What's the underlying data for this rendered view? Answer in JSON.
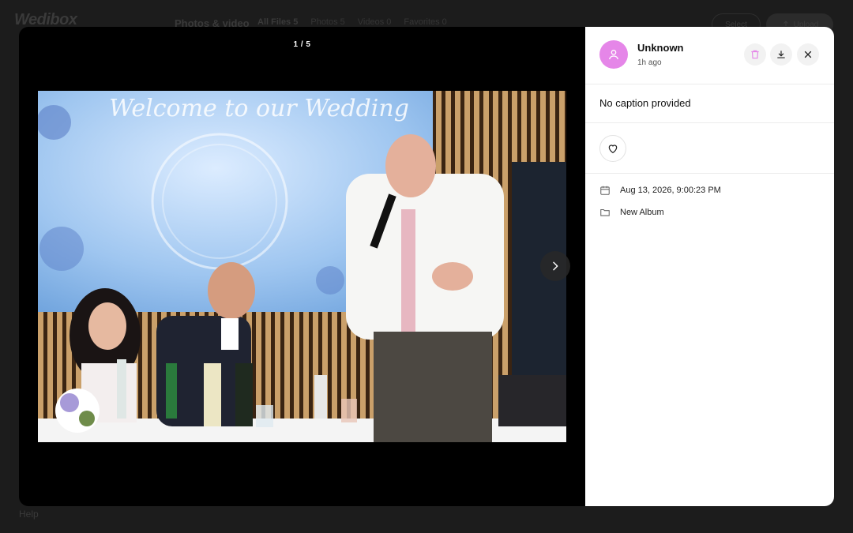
{
  "background": {
    "logo": "Wedibox",
    "title": "Photos & video",
    "tabs": [
      "All Files 5",
      "Photos 5",
      "Videos 0",
      "Favorites 0"
    ],
    "select_label": "Select",
    "upload_label": "Upload",
    "help_label": "Help"
  },
  "viewer": {
    "counter": "1 / 5",
    "photo_text": "Welcome to our Wedding"
  },
  "panel": {
    "user_name": "Unknown",
    "time_ago": "1h ago",
    "caption": "No caption provided",
    "date": "Aug 13, 2026, 9:00:23 PM",
    "album": "New Album"
  },
  "colors": {
    "avatar": "#e586e8",
    "trash_icon": "#e586e8",
    "viewer_bg": "#000000",
    "overlay_bg": "#1c1c1c"
  },
  "icons": [
    "user-icon",
    "trash-icon",
    "download-icon",
    "close-icon",
    "heart-icon",
    "calendar-icon",
    "folder-icon",
    "chevron-right-icon"
  ]
}
